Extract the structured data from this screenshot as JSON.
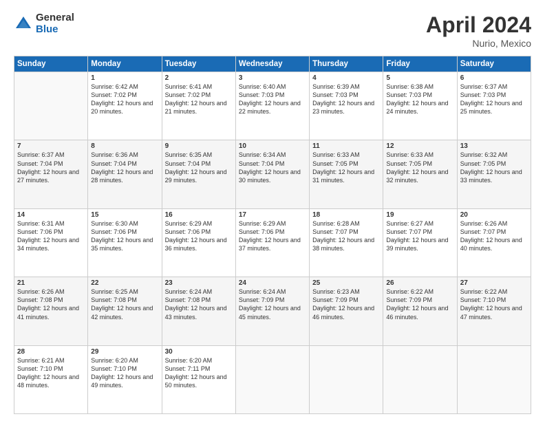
{
  "header": {
    "logo_general": "General",
    "logo_blue": "Blue",
    "month_title": "April 2024",
    "location": "Nurio, Mexico"
  },
  "days_of_week": [
    "Sunday",
    "Monday",
    "Tuesday",
    "Wednesday",
    "Thursday",
    "Friday",
    "Saturday"
  ],
  "weeks": [
    [
      {
        "day": "",
        "sunrise": "",
        "sunset": "",
        "daylight": ""
      },
      {
        "day": "1",
        "sunrise": "Sunrise: 6:42 AM",
        "sunset": "Sunset: 7:02 PM",
        "daylight": "Daylight: 12 hours and 20 minutes."
      },
      {
        "day": "2",
        "sunrise": "Sunrise: 6:41 AM",
        "sunset": "Sunset: 7:02 PM",
        "daylight": "Daylight: 12 hours and 21 minutes."
      },
      {
        "day": "3",
        "sunrise": "Sunrise: 6:40 AM",
        "sunset": "Sunset: 7:03 PM",
        "daylight": "Daylight: 12 hours and 22 minutes."
      },
      {
        "day": "4",
        "sunrise": "Sunrise: 6:39 AM",
        "sunset": "Sunset: 7:03 PM",
        "daylight": "Daylight: 12 hours and 23 minutes."
      },
      {
        "day": "5",
        "sunrise": "Sunrise: 6:38 AM",
        "sunset": "Sunset: 7:03 PM",
        "daylight": "Daylight: 12 hours and 24 minutes."
      },
      {
        "day": "6",
        "sunrise": "Sunrise: 6:37 AM",
        "sunset": "Sunset: 7:03 PM",
        "daylight": "Daylight: 12 hours and 25 minutes."
      }
    ],
    [
      {
        "day": "7",
        "sunrise": "Sunrise: 6:37 AM",
        "sunset": "Sunset: 7:04 PM",
        "daylight": "Daylight: 12 hours and 27 minutes."
      },
      {
        "day": "8",
        "sunrise": "Sunrise: 6:36 AM",
        "sunset": "Sunset: 7:04 PM",
        "daylight": "Daylight: 12 hours and 28 minutes."
      },
      {
        "day": "9",
        "sunrise": "Sunrise: 6:35 AM",
        "sunset": "Sunset: 7:04 PM",
        "daylight": "Daylight: 12 hours and 29 minutes."
      },
      {
        "day": "10",
        "sunrise": "Sunrise: 6:34 AM",
        "sunset": "Sunset: 7:04 PM",
        "daylight": "Daylight: 12 hours and 30 minutes."
      },
      {
        "day": "11",
        "sunrise": "Sunrise: 6:33 AM",
        "sunset": "Sunset: 7:05 PM",
        "daylight": "Daylight: 12 hours and 31 minutes."
      },
      {
        "day": "12",
        "sunrise": "Sunrise: 6:33 AM",
        "sunset": "Sunset: 7:05 PM",
        "daylight": "Daylight: 12 hours and 32 minutes."
      },
      {
        "day": "13",
        "sunrise": "Sunrise: 6:32 AM",
        "sunset": "Sunset: 7:05 PM",
        "daylight": "Daylight: 12 hours and 33 minutes."
      }
    ],
    [
      {
        "day": "14",
        "sunrise": "Sunrise: 6:31 AM",
        "sunset": "Sunset: 7:06 PM",
        "daylight": "Daylight: 12 hours and 34 minutes."
      },
      {
        "day": "15",
        "sunrise": "Sunrise: 6:30 AM",
        "sunset": "Sunset: 7:06 PM",
        "daylight": "Daylight: 12 hours and 35 minutes."
      },
      {
        "day": "16",
        "sunrise": "Sunrise: 6:29 AM",
        "sunset": "Sunset: 7:06 PM",
        "daylight": "Daylight: 12 hours and 36 minutes."
      },
      {
        "day": "17",
        "sunrise": "Sunrise: 6:29 AM",
        "sunset": "Sunset: 7:06 PM",
        "daylight": "Daylight: 12 hours and 37 minutes."
      },
      {
        "day": "18",
        "sunrise": "Sunrise: 6:28 AM",
        "sunset": "Sunset: 7:07 PM",
        "daylight": "Daylight: 12 hours and 38 minutes."
      },
      {
        "day": "19",
        "sunrise": "Sunrise: 6:27 AM",
        "sunset": "Sunset: 7:07 PM",
        "daylight": "Daylight: 12 hours and 39 minutes."
      },
      {
        "day": "20",
        "sunrise": "Sunrise: 6:26 AM",
        "sunset": "Sunset: 7:07 PM",
        "daylight": "Daylight: 12 hours and 40 minutes."
      }
    ],
    [
      {
        "day": "21",
        "sunrise": "Sunrise: 6:26 AM",
        "sunset": "Sunset: 7:08 PM",
        "daylight": "Daylight: 12 hours and 41 minutes."
      },
      {
        "day": "22",
        "sunrise": "Sunrise: 6:25 AM",
        "sunset": "Sunset: 7:08 PM",
        "daylight": "Daylight: 12 hours and 42 minutes."
      },
      {
        "day": "23",
        "sunrise": "Sunrise: 6:24 AM",
        "sunset": "Sunset: 7:08 PM",
        "daylight": "Daylight: 12 hours and 43 minutes."
      },
      {
        "day": "24",
        "sunrise": "Sunrise: 6:24 AM",
        "sunset": "Sunset: 7:09 PM",
        "daylight": "Daylight: 12 hours and 45 minutes."
      },
      {
        "day": "25",
        "sunrise": "Sunrise: 6:23 AM",
        "sunset": "Sunset: 7:09 PM",
        "daylight": "Daylight: 12 hours and 46 minutes."
      },
      {
        "day": "26",
        "sunrise": "Sunrise: 6:22 AM",
        "sunset": "Sunset: 7:09 PM",
        "daylight": "Daylight: 12 hours and 46 minutes."
      },
      {
        "day": "27",
        "sunrise": "Sunrise: 6:22 AM",
        "sunset": "Sunset: 7:10 PM",
        "daylight": "Daylight: 12 hours and 47 minutes."
      }
    ],
    [
      {
        "day": "28",
        "sunrise": "Sunrise: 6:21 AM",
        "sunset": "Sunset: 7:10 PM",
        "daylight": "Daylight: 12 hours and 48 minutes."
      },
      {
        "day": "29",
        "sunrise": "Sunrise: 6:20 AM",
        "sunset": "Sunset: 7:10 PM",
        "daylight": "Daylight: 12 hours and 49 minutes."
      },
      {
        "day": "30",
        "sunrise": "Sunrise: 6:20 AM",
        "sunset": "Sunset: 7:11 PM",
        "daylight": "Daylight: 12 hours and 50 minutes."
      },
      {
        "day": "",
        "sunrise": "",
        "sunset": "",
        "daylight": ""
      },
      {
        "day": "",
        "sunrise": "",
        "sunset": "",
        "daylight": ""
      },
      {
        "day": "",
        "sunrise": "",
        "sunset": "",
        "daylight": ""
      },
      {
        "day": "",
        "sunrise": "",
        "sunset": "",
        "daylight": ""
      }
    ]
  ]
}
